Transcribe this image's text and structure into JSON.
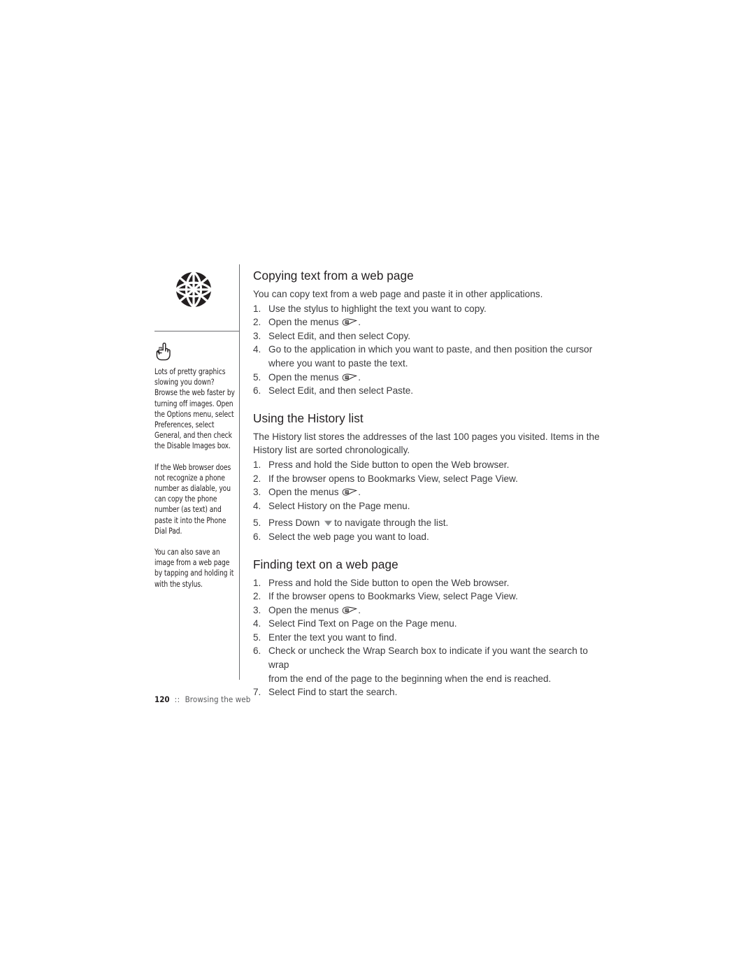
{
  "page": {
    "number": "120",
    "separator": "::",
    "running_title": "Browsing the web"
  },
  "sidebar": {
    "section_icon": "globe-icon",
    "tip_icon": "pointing-hand-icon",
    "notes": [
      "Lots of pretty graphics slowing you down? Browse the web faster by turning off images. Open the Options menu, select Preferences, select General, and then check the Disable Images box.",
      "If the Web browser does not recognize a phone number as dialable, you can copy the phone number (as text) and paste it into the Phone Dial Pad.",
      "You can also save an image from a web page by tapping and holding it with the stylus."
    ]
  },
  "sections": [
    {
      "heading": "Copying text from a web page",
      "intro": "You can copy text from a web page and paste it in other applications.",
      "steps": [
        {
          "num": "1.",
          "text": "Use the stylus to highlight the text you want to copy."
        },
        {
          "num": "2.",
          "pre": "Open the menus",
          "icon": "menu-button-icon",
          "post": "."
        },
        {
          "num": "3.",
          "text": "Select Edit, and then select Copy."
        },
        {
          "num": "4.",
          "text": "Go to the application in which you want to paste, and then position the cursor",
          "cont": "where you want to paste the text."
        },
        {
          "num": "5.",
          "pre": "Open the menus",
          "icon": "menu-button-icon",
          "post": "."
        },
        {
          "num": "6.",
          "text": "Select Edit, and then select Paste."
        }
      ]
    },
    {
      "heading": "Using the History list",
      "intro": "The History list stores the addresses of the last 100 pages you visited. Items in the History list are sorted chronologically.",
      "steps": [
        {
          "num": "1.",
          "text": "Press and hold the Side button to open the Web browser."
        },
        {
          "num": "2.",
          "text": "If the browser opens to Bookmarks View, select Page View."
        },
        {
          "num": "3.",
          "pre": "Open the menus",
          "icon": "menu-button-icon",
          "post": "."
        },
        {
          "num": "4.",
          "text": "Select History on the Page menu."
        },
        {
          "num": "5.",
          "pre": "Press Down",
          "icon": "down-arrow-icon",
          "post": "to navigate through the list."
        },
        {
          "num": "6.",
          "text": "Select the web page you want to load."
        }
      ]
    },
    {
      "heading": "Finding text on a web page",
      "intro": "",
      "steps": [
        {
          "num": "1.",
          "text": "Press and hold the Side button to open the Web browser."
        },
        {
          "num": "2.",
          "text": "If the browser opens to Bookmarks View, select Page View."
        },
        {
          "num": "3.",
          "pre": "Open the menus",
          "icon": "menu-button-icon",
          "post": "."
        },
        {
          "num": "4.",
          "text": "Select Find Text on Page on the Page menu."
        },
        {
          "num": "5.",
          "text": "Enter the text you want to find."
        },
        {
          "num": "6.",
          "text": "Check or uncheck the Wrap Search box to indicate if you want the search to  wrap",
          "cont": "from the end of the page to the beginning when the end is reached."
        },
        {
          "num": "7.",
          "text": "Select Find to start the search."
        }
      ]
    }
  ],
  "colors": {
    "ink": "#231f20",
    "body_text": "#3b3b3d",
    "rule": "#6d6e71",
    "page_background": "#ffffff",
    "arrow_gray": "#8b8c8e"
  }
}
